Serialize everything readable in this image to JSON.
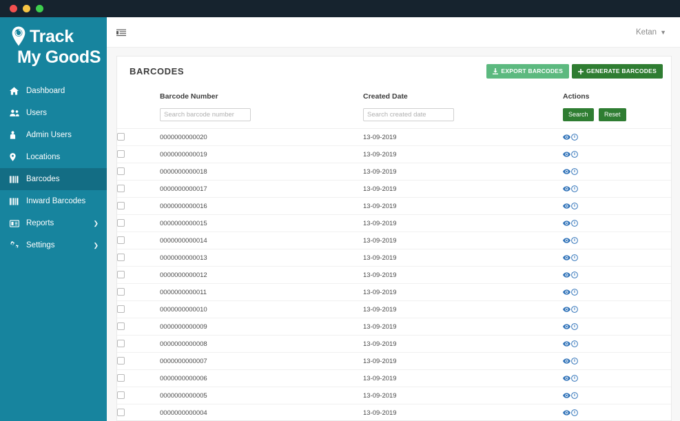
{
  "window": {
    "traffic_lights": [
      "close",
      "minimize",
      "maximize"
    ]
  },
  "sidebar": {
    "brand": {
      "line1": "Track",
      "line2": "My GoodS",
      "logo_icon": "map-pin-gear-icon"
    },
    "items": [
      {
        "label": "Dashboard",
        "icon": "home-icon",
        "active": false,
        "has_chevron": false
      },
      {
        "label": "Users",
        "icon": "users-icon",
        "active": false,
        "has_chevron": false
      },
      {
        "label": "Admin Users",
        "icon": "user-icon",
        "active": false,
        "has_chevron": false
      },
      {
        "label": "Locations",
        "icon": "map-pin-icon",
        "active": false,
        "has_chevron": false
      },
      {
        "label": "Barcodes",
        "icon": "barcode-icon",
        "active": true,
        "has_chevron": false
      },
      {
        "label": "Inward Barcodes",
        "icon": "barcode-icon",
        "active": false,
        "has_chevron": false
      },
      {
        "label": "Reports",
        "icon": "report-icon",
        "active": false,
        "has_chevron": true
      },
      {
        "label": "Settings",
        "icon": "gears-icon",
        "active": false,
        "has_chevron": true
      }
    ]
  },
  "topbar": {
    "toggle_icon": "sidebar-toggle-icon",
    "user_name": "Ketan",
    "user_chevron_icon": "chevron-down-icon"
  },
  "page": {
    "title": "BARCODES",
    "export_button": {
      "label": "EXPORT BARCODES",
      "icon": "download-icon"
    },
    "generate_button": {
      "label": "GENERATE BARCODES",
      "icon": "plus-icon"
    }
  },
  "table": {
    "columns": [
      "",
      "Barcode Number",
      "Created Date",
      "Actions"
    ],
    "filters": {
      "barcode_placeholder": "Search barcode number",
      "barcode_value": "",
      "date_placeholder": "Search created date",
      "date_value": "",
      "search_label": "Search",
      "reset_label": "Reset"
    },
    "row_action_icons": [
      "eye-icon",
      "info-circle-icon"
    ],
    "rows": [
      {
        "barcode": "0000000000020",
        "created": "13-09-2019"
      },
      {
        "barcode": "0000000000019",
        "created": "13-09-2019"
      },
      {
        "barcode": "0000000000018",
        "created": "13-09-2019"
      },
      {
        "barcode": "0000000000017",
        "created": "13-09-2019"
      },
      {
        "barcode": "0000000000016",
        "created": "13-09-2019"
      },
      {
        "barcode": "0000000000015",
        "created": "13-09-2019"
      },
      {
        "barcode": "0000000000014",
        "created": "13-09-2019"
      },
      {
        "barcode": "0000000000013",
        "created": "13-09-2019"
      },
      {
        "barcode": "0000000000012",
        "created": "13-09-2019"
      },
      {
        "barcode": "0000000000011",
        "created": "13-09-2019"
      },
      {
        "barcode": "0000000000010",
        "created": "13-09-2019"
      },
      {
        "barcode": "0000000000009",
        "created": "13-09-2019"
      },
      {
        "barcode": "0000000000008",
        "created": "13-09-2019"
      },
      {
        "barcode": "0000000000007",
        "created": "13-09-2019"
      },
      {
        "barcode": "0000000000006",
        "created": "13-09-2019"
      },
      {
        "barcode": "0000000000005",
        "created": "13-09-2019"
      },
      {
        "barcode": "0000000000004",
        "created": "13-09-2019"
      }
    ]
  },
  "colors": {
    "titlebar": "#16232e",
    "sidebar": "#17849e",
    "sidebar_active": "#136d84",
    "export_green": "#5cb97f",
    "generate_green": "#2f7d32",
    "action_blue": "#2f72b8",
    "page_bg": "#f7f7f7"
  }
}
